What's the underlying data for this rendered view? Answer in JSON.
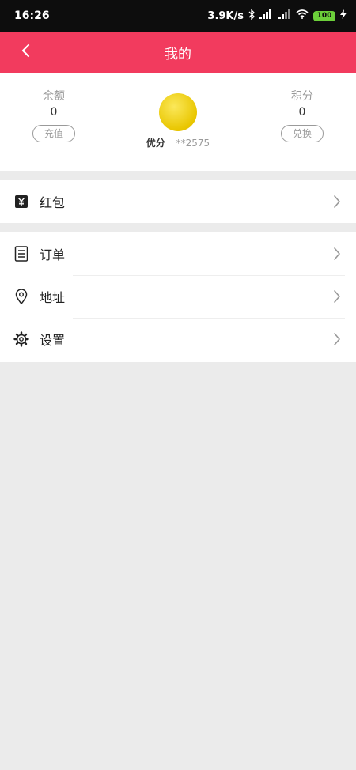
{
  "status_bar": {
    "time": "16:26",
    "network_speed": "3.9K/s",
    "battery_level": "100",
    "icons": [
      "bluetooth-icon",
      "signal-icon",
      "wifi-icon",
      "battery-icon",
      "charging-icon"
    ]
  },
  "header": {
    "title": "我的",
    "background_color": "#f23b5e"
  },
  "profile": {
    "balance": {
      "label": "余额",
      "value": "0",
      "button": "充值"
    },
    "points": {
      "label": "积分",
      "value": "0",
      "button": "兑换"
    },
    "user": {
      "name": "优分",
      "id": "**2575"
    }
  },
  "menu": {
    "group1": [
      {
        "label": "红包",
        "icon": "red-packet-icon"
      }
    ],
    "group2": [
      {
        "label": "订单",
        "icon": "order-icon"
      },
      {
        "label": "地址",
        "icon": "location-pin-icon"
      },
      {
        "label": "设置",
        "icon": "gear-icon"
      }
    ]
  }
}
